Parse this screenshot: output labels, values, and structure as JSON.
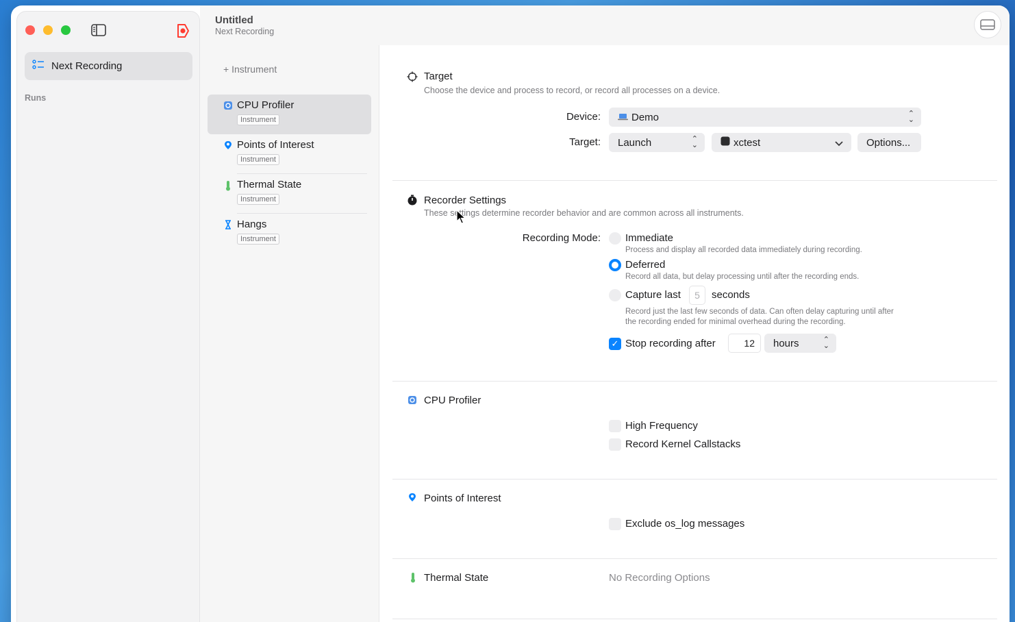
{
  "window": {
    "title": "Untitled",
    "subtitle": "Next Recording"
  },
  "sidebar": {
    "items": [
      {
        "label": "Next Recording",
        "icon": "list-icon"
      }
    ],
    "runs_label": "Runs"
  },
  "instruments": {
    "add_label": "Instrument",
    "items": [
      {
        "name": "CPU Profiler",
        "tag": "Instrument",
        "icon": "gear-icon",
        "selected": true
      },
      {
        "name": "Points of Interest",
        "tag": "Instrument",
        "icon": "pin-icon",
        "selected": false
      },
      {
        "name": "Thermal State",
        "tag": "Instrument",
        "icon": "thermometer-icon",
        "selected": false
      },
      {
        "name": "Hangs",
        "tag": "Instrument",
        "icon": "hourglass-icon",
        "selected": false
      }
    ]
  },
  "target_section": {
    "title": "Target",
    "description": "Choose the device and process to record, or record all processes on a device.",
    "device_label": "Device:",
    "device_value": "Demo",
    "target_label": "Target:",
    "target_mode": "Launch",
    "target_process": "xctest",
    "options_button": "Options..."
  },
  "recorder_section": {
    "title": "Recorder Settings",
    "description": "These settings determine recorder behavior and are common across all instruments.",
    "mode_label": "Recording Mode:",
    "immediate_label": "Immediate",
    "immediate_desc": "Process and display all recorded data immediately during recording.",
    "deferred_label": "Deferred",
    "deferred_desc": "Record all data, but delay processing until after the recording ends.",
    "capture_label": "Capture last",
    "capture_value": "5",
    "capture_unit": "seconds",
    "capture_desc_1": "Record just the last few seconds of data. Can often delay capturing until after",
    "capture_desc_2": "the recording ended for minimal overhead during the recording.",
    "selected_mode": "Deferred",
    "stop_label": "Stop recording after",
    "stop_checked": true,
    "stop_value": "12",
    "stop_unit": "hours"
  },
  "cpu_section": {
    "title": "CPU Profiler",
    "high_frequency": "High Frequency",
    "kernel_callstacks": "Record Kernel Callstacks"
  },
  "poi_section": {
    "title": "Points of Interest",
    "exclude_oslog": "Exclude os_log messages"
  },
  "thermal_section": {
    "title": "Thermal State",
    "no_options": "No Recording Options"
  },
  "colors": {
    "accent": "#0a84ff",
    "record": "#ff3b30"
  }
}
